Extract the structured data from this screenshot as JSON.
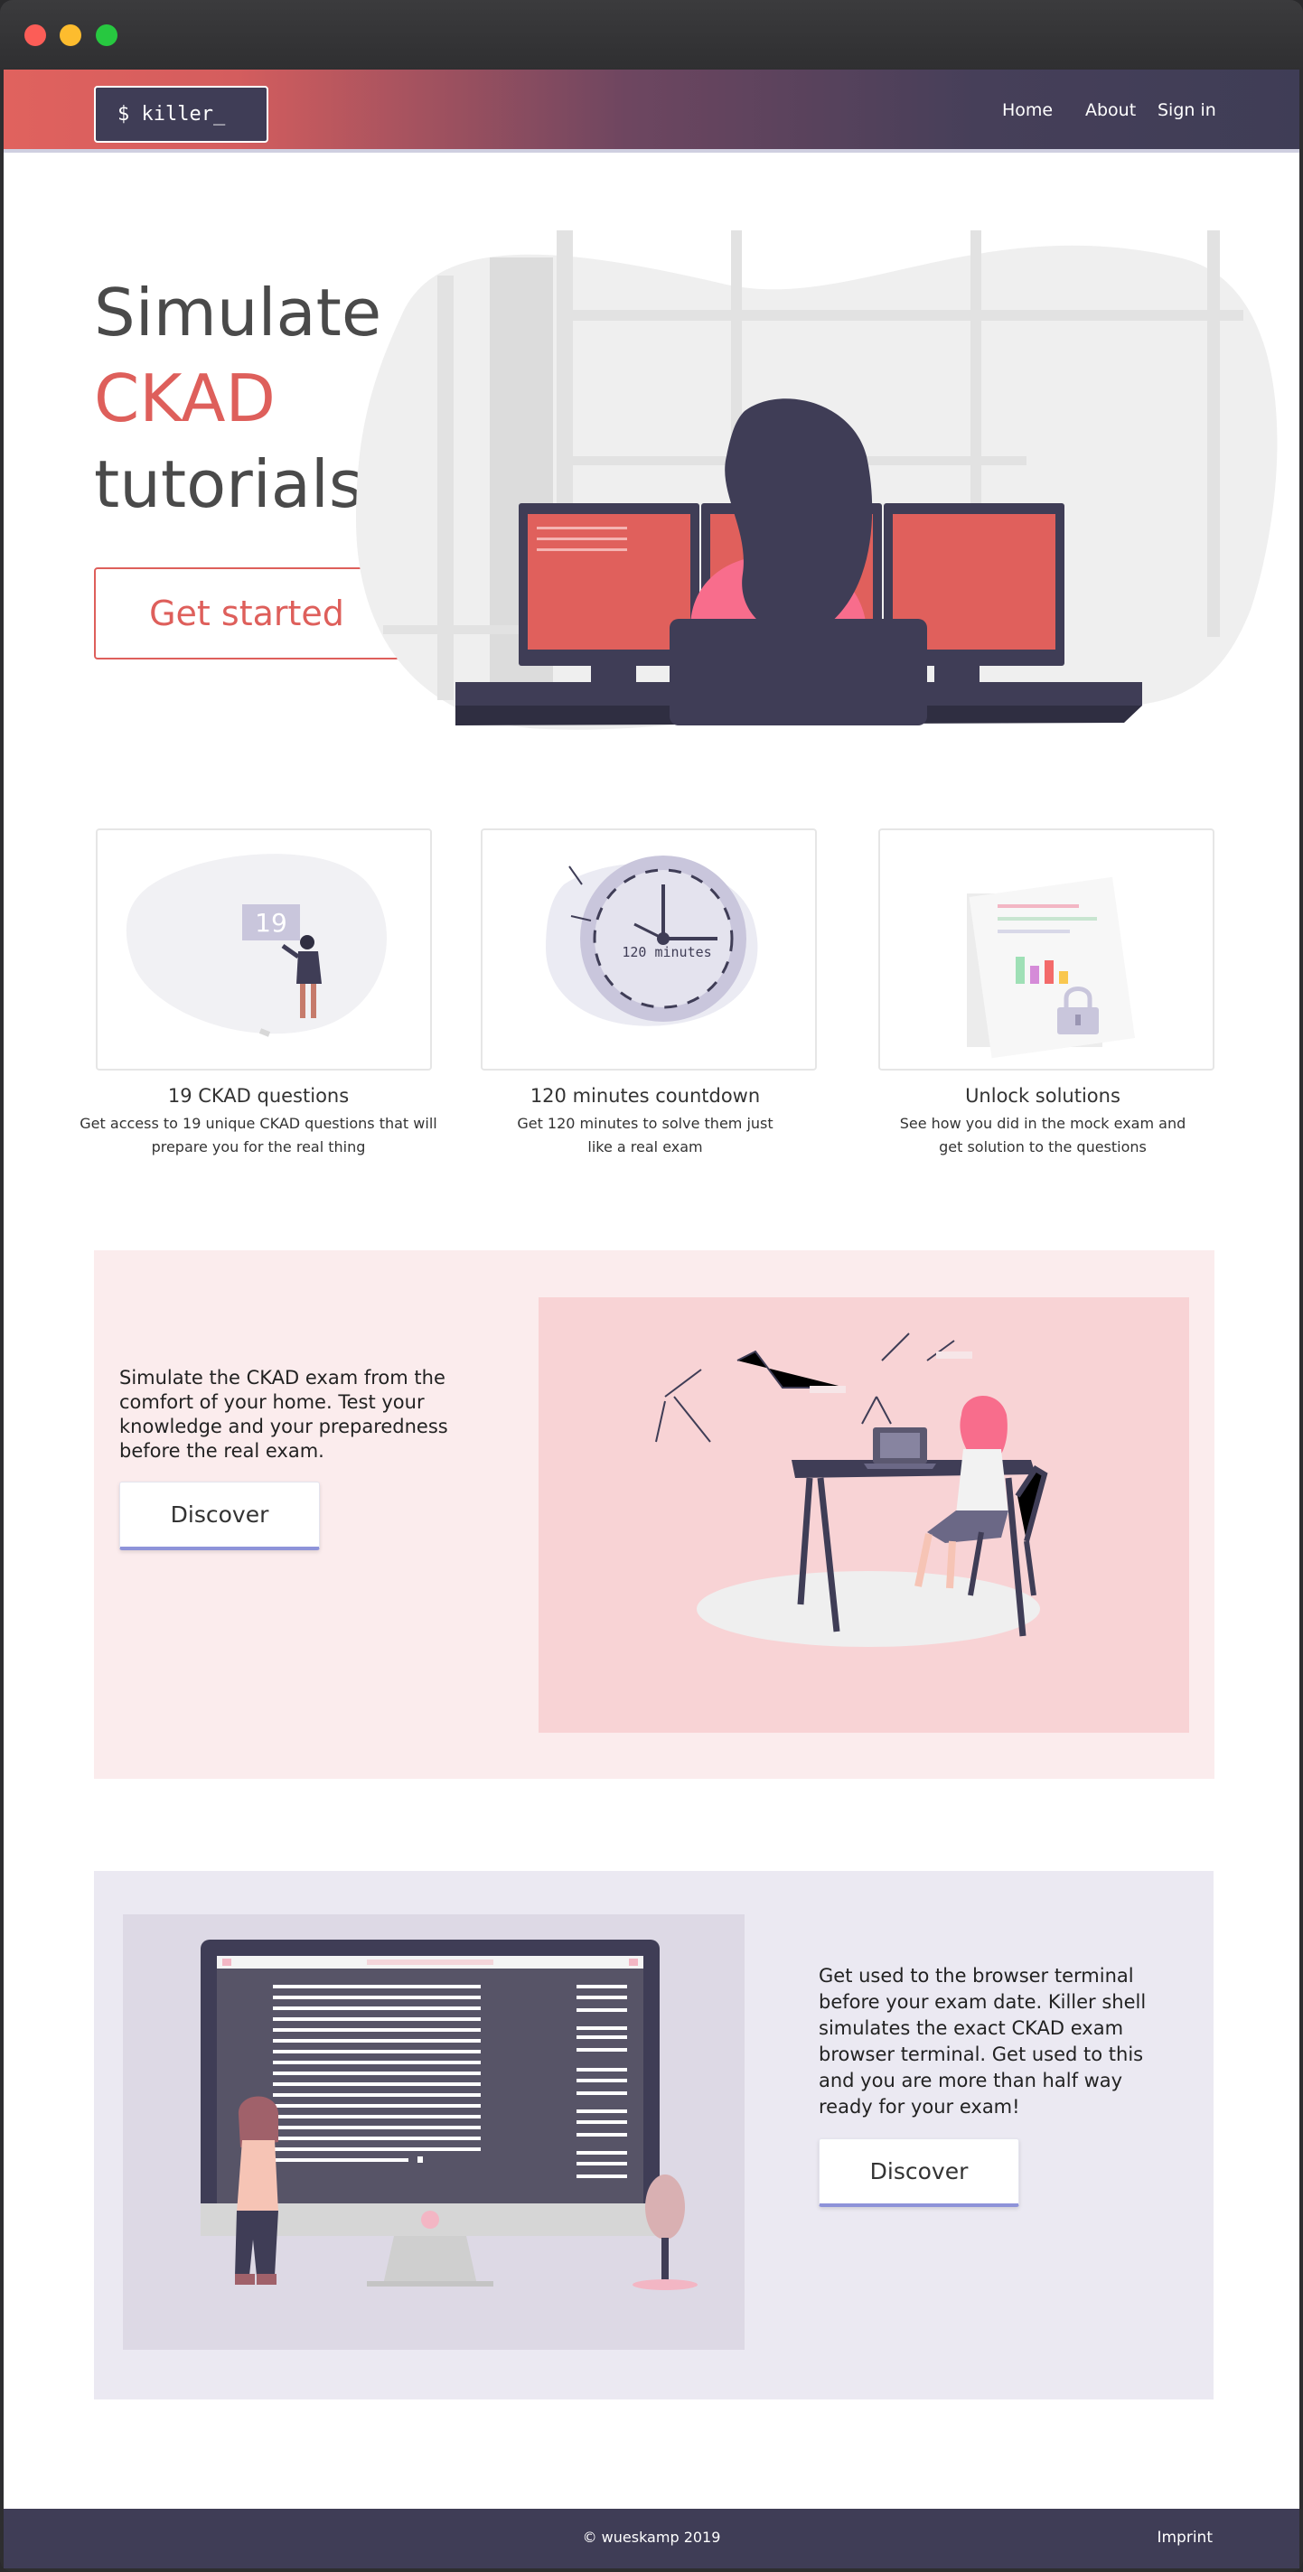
{
  "window": {
    "controls": [
      "close",
      "minimize",
      "maximize"
    ],
    "colors": {
      "close": "#fc5d57",
      "minimize": "#fdbc2e",
      "maximize": "#27c840"
    }
  },
  "header": {
    "logo": "$ killer_",
    "nav": {
      "home": "Home",
      "about": "About",
      "signin": "Sign in"
    }
  },
  "hero": {
    "line1": "Simulate",
    "line2": "CKAD",
    "line3": "tutorials",
    "cta": "Get started"
  },
  "features": [
    {
      "title": "19 CKAD questions",
      "description": "Get access to 19 unique CKAD questions that will prepare you for the real thing",
      "badge": "19",
      "icon": "presenter-illustration"
    },
    {
      "title": "120 minutes countdown",
      "description": "Get 120 minutes to solve them just like a real exam",
      "clock_label": "120 minutes",
      "icon": "clock-illustration"
    },
    {
      "title": "Unlock solutions",
      "description": "See how you did in the mock exam and get solution to the questions",
      "icon": "locked-report-illustration"
    }
  ],
  "section_simulate": {
    "text": "Simulate the CKAD exam from the comfort of your home.  Test your knowledge and your preparedness before the real exam.",
    "button": "Discover"
  },
  "section_terminal": {
    "text": "Get used to the browser terminal before your exam date. Killer shell simulates the exact CKAD exam browser terminal. Get used to this and you are more than half way ready for your exam!",
    "button": "Discover"
  },
  "footer": {
    "copyright": "© wueskamp 2019",
    "imprint": "Imprint"
  },
  "colors": {
    "accent": "#de5f5b",
    "navy": "#3f3d56",
    "pink_section": "#fbeced",
    "lavender_section": "#ebe9f2",
    "discover_underline": "#8e93d9"
  }
}
